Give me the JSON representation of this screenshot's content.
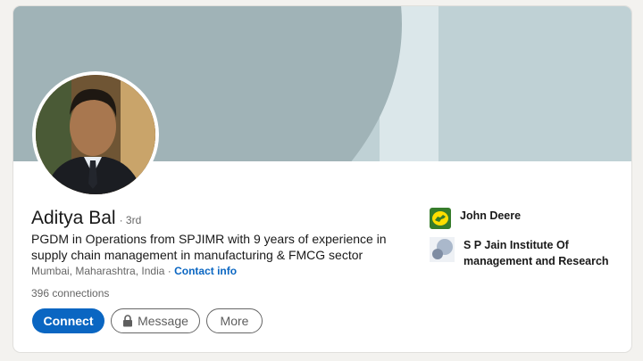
{
  "profile": {
    "name": "Aditya Bal",
    "degree": "· 3rd",
    "headline": "PGDM in Operations from SPJIMR with 9 years of experience in supply chain management in manufacturing & FMCG sector",
    "location": "Mumbai, Maharashtra, India",
    "separator": "·",
    "contact_label": "Contact info",
    "connections": "396 connections"
  },
  "actions": {
    "connect": "Connect",
    "message": "Message",
    "more": "More"
  },
  "orgs": [
    {
      "name": "John Deere",
      "icon": "john-deere-logo"
    },
    {
      "name": "S P Jain Institute Of management and Research",
      "icon": "sp-jain-logo"
    }
  ],
  "colors": {
    "brand_blue": "#0a66c2",
    "banner": "#a0b3b7",
    "john_deere_green": "#367c2b",
    "john_deere_yellow": "#ffde00"
  }
}
